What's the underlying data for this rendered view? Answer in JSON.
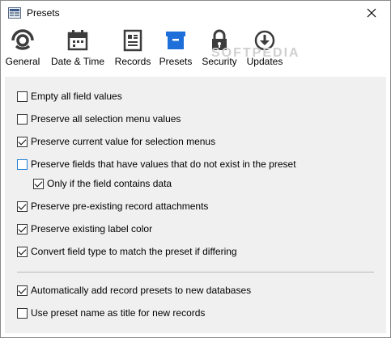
{
  "window": {
    "title": "Presets",
    "close_glyph": "✕"
  },
  "toolbar": {
    "items": [
      {
        "label": "General",
        "icon": "gear-icon"
      },
      {
        "label": "Date & Time",
        "icon": "calendar-icon"
      },
      {
        "label": "Records",
        "icon": "records-icon"
      },
      {
        "label": "Presets",
        "icon": "presets-icon",
        "active": true
      },
      {
        "label": "Security",
        "icon": "lock-icon"
      },
      {
        "label": "Updates",
        "icon": "download-icon"
      }
    ],
    "active_color": "#1e6fd9"
  },
  "watermark": "SOFTPEDIA",
  "options": [
    {
      "label": "Empty all field values",
      "checked": false
    },
    {
      "label": "Preserve all selection menu values",
      "checked": false
    },
    {
      "label": "Preserve current value for selection menus",
      "checked": true
    },
    {
      "label": "Preserve fields that have values that do not exist in the preset",
      "checked": false,
      "focused": true
    },
    {
      "label": "Only if the field contains data",
      "checked": true
    },
    {
      "label": "Preserve pre-existing record attachments",
      "checked": true
    },
    {
      "label": "Preserve existing label color",
      "checked": true
    },
    {
      "label": "Convert field type to match the preset if differing",
      "checked": true
    },
    {
      "label": "Automatically add record presets to new databases",
      "checked": true
    },
    {
      "label": "Use preset name as title for new records",
      "checked": false
    }
  ]
}
